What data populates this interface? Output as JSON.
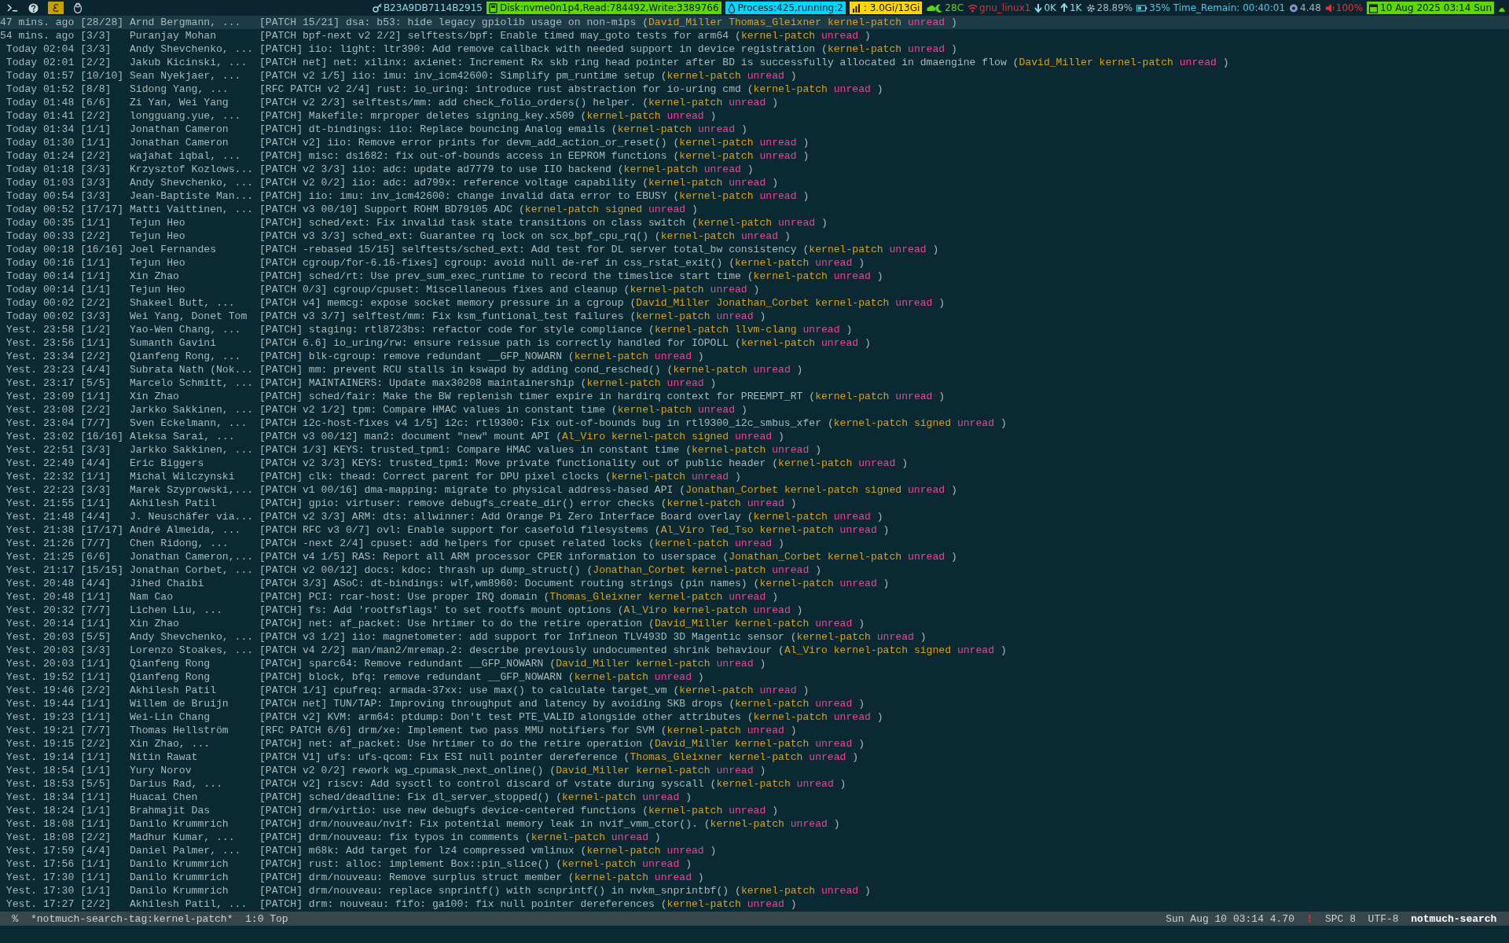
{
  "top_bar": {
    "segments": [
      {
        "kind": "label",
        "text": "B23A9DB7114B2915",
        "color": "#8fd8e8"
      },
      {
        "kind": "badge",
        "text": "Disk:nvme0n1p4,Read:784492,Write:3389766",
        "color": "#5fd700"
      },
      {
        "kind": "badge",
        "text": "Process:425,running:2",
        "color": "#00d7ff"
      },
      {
        "kind": "badge",
        "text": ": 3.0Gi/13Gi",
        "color": "#ffd700"
      },
      {
        "kind": "label",
        "text": "28C",
        "color": "#5fd700"
      },
      {
        "kind": "label",
        "text": "gnu_linux1",
        "color": "#e0303a"
      },
      {
        "kind": "label",
        "text": "0K",
        "color": "#8fd8e8"
      },
      {
        "kind": "label",
        "text": "1K",
        "color": "#8fd8e8"
      },
      {
        "kind": "label",
        "text": "28.89%",
        "color": "#a8b4b8"
      },
      {
        "kind": "label",
        "text": "35% Time_Remain: 00:40:01",
        "color": "#4fc8e8"
      },
      {
        "kind": "label",
        "text": "4.48",
        "color": "#a8b4b8"
      },
      {
        "kind": "label",
        "text": "100%",
        "color": "#f03030"
      },
      {
        "kind": "badge",
        "text": "10 Aug 2025 03:14 Sun",
        "color": "#5fd700"
      }
    ]
  },
  "threads": [
    {
      "selected": true,
      "date": "47 mins. ago",
      "count": "[28/28]",
      "authors": "Arnd Bergmann, ...",
      "subject": "[PATCH 15/21] dsa: b53: hide legacy gpiolib usage on non-mips (",
      "tags": [
        {
          "text": "David_Miller",
          "color": "#d7a020"
        },
        {
          "text": "Thomas_Gleixner",
          "color": "#d7a020"
        },
        {
          "text": "kernel-patch",
          "color": "#d7a020"
        },
        {
          "text": "unread",
          "color": "#e8469a"
        }
      ],
      "end": ")"
    },
    {
      "selected": false,
      "date": "54 mins. ago",
      "count": "[3/3]",
      "authors": "Puranjay Mohan",
      "subject": "[PATCH bpf-next v2 2/2] selftests/bpf: Enable timed may_goto tests for arm64 (",
      "tags": [
        {
          "text": "kernel-patch",
          "color": "#d7a020"
        },
        {
          "text": "unread",
          "color": "#e8469a"
        }
      ],
      "end": ")"
    },
    {
      "selected": false,
      "date": "Today 02:04",
      "count": "[3/3]",
      "authors": "Andy Shevchenko, ...",
      "subject": "[PATCH] iio: light: ltr390: Add remove callback with needed support in device registration (",
      "tags": [
        {
          "text": "kernel-patch",
          "color": "#d7a020"
        },
        {
          "text": "unread",
          "color": "#e8469a"
        }
      ],
      "end": ")"
    },
    {
      "selected": false,
      "date": "Today 02:01",
      "count": "[2/2]",
      "authors": "Jakub Kicinski, ...",
      "subject": "[PATCH net] net: xilinx: axienet: Increment Rx skb ring head pointer after BD is successfully allocated in dmaengine flow (",
      "tags": [
        {
          "text": "David_Miller",
          "color": "#d7a020"
        },
        {
          "text": "kernel-patch",
          "color": "#d7a020"
        },
        {
          "text": "unread",
          "color": "#e8469a"
        }
      ],
      "end": ")"
    },
    {
      "selected": false,
      "date": "Today 01:57",
      "count": "[10/10]",
      "authors": "Sean Nyekjaer, ...",
      "subject": "[PATCH v2 1/5] iio: imu: inv_icm42600: Simplify pm_runtime setup (",
      "tags": [
        {
          "text": "kernel-patch",
          "color": "#d7a020"
        },
        {
          "text": "unread",
          "color": "#e8469a"
        }
      ],
      "end": ")"
    },
    {
      "selected": false,
      "date": "Today 01:52",
      "count": "[8/8]",
      "authors": "Sidong Yang, ...",
      "subject": "[RFC PATCH v2 2/4] rust: io_uring: introduce rust abstraction for io-uring cmd (",
      "tags": [
        {
          "text": "kernel-patch",
          "color": "#d7a020"
        },
        {
          "text": "unread",
          "color": "#e8469a"
        }
      ],
      "end": ")"
    },
    {
      "selected": false,
      "date": "Today 01:48",
      "count": "[6/6]",
      "authors": "Zi Yan, Wei Yang",
      "subject": "[PATCH v2 2/3] selftests/mm: add check_folio_orders() helper. (",
      "tags": [
        {
          "text": "kernel-patch",
          "color": "#d7a020"
        },
        {
          "text": "unread",
          "color": "#e8469a"
        }
      ],
      "end": ")"
    },
    {
      "selected": false,
      "date": "Today 01:41",
      "count": "[2/2]",
      "authors": "longguang.yue, ...",
      "subject": "[PATCH] Makefile: mrproper deletes signing_key.x509 (",
      "tags": [
        {
          "text": "kernel-patch",
          "color": "#d7a020"
        },
        {
          "text": "unread",
          "color": "#e8469a"
        }
      ],
      "end": ")"
    },
    {
      "selected": false,
      "date": "Today 01:34",
      "count": "[1/1]",
      "authors": "Jonathan Cameron",
      "subject": "[PATCH] dt-bindings: iio: Replace bouncing Analog emails (",
      "tags": [
        {
          "text": "kernel-patch",
          "color": "#d7a020"
        },
        {
          "text": "unread",
          "color": "#e8469a"
        }
      ],
      "end": ")"
    },
    {
      "selected": false,
      "date": "Today 01:30",
      "count": "[1/1]",
      "authors": "Jonathan Cameron",
      "subject": "[PATCH v2] iio: Remove error prints for devm_add_action_or_reset() (",
      "tags": [
        {
          "text": "kernel-patch",
          "color": "#d7a020"
        },
        {
          "text": "unread",
          "color": "#e8469a"
        }
      ],
      "end": ")"
    },
    {
      "selected": false,
      "date": "Today 01:24",
      "count": "[2/2]",
      "authors": "wajahat iqbal, ...",
      "subject": "[PATCH] misc: ds1682: fix out-of-bounds access in EEPROM functions (",
      "tags": [
        {
          "text": "kernel-patch",
          "color": "#d7a020"
        },
        {
          "text": "unread",
          "color": "#e8469a"
        }
      ],
      "end": ")"
    },
    {
      "selected": false,
      "date": "Today 01:18",
      "count": "[3/3]",
      "authors": "Krzysztof Kozlows...",
      "subject": "[PATCH v2 3/3] iio: adc: update ad7779 to use IIO backend (",
      "tags": [
        {
          "text": "kernel-patch",
          "color": "#d7a020"
        },
        {
          "text": "unread",
          "color": "#e8469a"
        }
      ],
      "end": ")"
    },
    {
      "selected": false,
      "date": "Today 01:03",
      "count": "[3/3]",
      "authors": "Andy Shevchenko, ...",
      "subject": "[PATCH v2 0/2] iio: adc: ad799x: reference voltage capability (",
      "tags": [
        {
          "text": "kernel-patch",
          "color": "#d7a020"
        },
        {
          "text": "unread",
          "color": "#e8469a"
        }
      ],
      "end": ")"
    },
    {
      "selected": false,
      "date": "Today 00:54",
      "count": "[3/3]",
      "authors": "Jean-Baptiste Man...",
      "subject": "[PATCH] iio: imu: inv_icm42600: change invalid data error to EBUSY (",
      "tags": [
        {
          "text": "kernel-patch",
          "color": "#d7a020"
        },
        {
          "text": "unread",
          "color": "#e8469a"
        }
      ],
      "end": ")"
    },
    {
      "selected": false,
      "date": "Today 00:52",
      "count": "[17/17]",
      "authors": "Matti Vaittinen, ...",
      "subject": "[PATCH v3 00/10] Support ROHM BD79105 ADC (",
      "tags": [
        {
          "text": "kernel-patch",
          "color": "#d7a020"
        },
        {
          "text": "signed",
          "color": "#d7a020"
        },
        {
          "text": "unread",
          "color": "#e8469a"
        }
      ],
      "end": ")"
    },
    {
      "selected": false,
      "date": "Today 00:35",
      "count": "[1/1]",
      "authors": "Tejun Heo",
      "subject": "[PATCH] sched/ext: Fix invalid task state transitions on class switch (",
      "tags": [
        {
          "text": "kernel-patch",
          "color": "#d7a020"
        },
        {
          "text": "unread",
          "color": "#e8469a"
        }
      ],
      "end": ")"
    },
    {
      "selected": false,
      "date": "Today 00:33",
      "count": "[2/2]",
      "authors": "Tejun Heo",
      "subject": "[PATCH v3 3/3] sched_ext: Guarantee rq lock on scx_bpf_cpu_rq() (",
      "tags": [
        {
          "text": "kernel-patch",
          "color": "#d7a020"
        },
        {
          "text": "unread",
          "color": "#e8469a"
        }
      ],
      "end": ")"
    },
    {
      "selected": false,
      "date": "Today 00:18",
      "count": "[16/16]",
      "authors": "Joel Fernandes",
      "subject": "[PATCH -rebased 15/15] selftests/sched_ext: Add test for DL server total_bw consistency (",
      "tags": [
        {
          "text": "kernel-patch",
          "color": "#d7a020"
        },
        {
          "text": "unread",
          "color": "#e8469a"
        }
      ],
      "end": ")"
    },
    {
      "selected": false,
      "date": "Today 00:16",
      "count": "[1/1]",
      "authors": "Tejun Heo",
      "subject": "[PATCH cgroup/for-6.16-fixes] cgroup: avoid null de-ref in css_rstat_exit() (",
      "tags": [
        {
          "text": "kernel-patch",
          "color": "#d7a020"
        },
        {
          "text": "unread",
          "color": "#e8469a"
        }
      ],
      "end": ")"
    },
    {
      "selected": false,
      "date": "Today 00:14",
      "count": "[1/1]",
      "authors": "Xin Zhao",
      "subject": "[PATCH] sched/rt: Use prev_sum_exec_runtime to record the timeslice start time (",
      "tags": [
        {
          "text": "kernel-patch",
          "color": "#d7a020"
        },
        {
          "text": "unread",
          "color": "#e8469a"
        }
      ],
      "end": ")"
    },
    {
      "selected": false,
      "date": "Today 00:14",
      "count": "[1/1]",
      "authors": "Tejun Heo",
      "subject": "[PATCH 0/3] cgroup/cpuset: Miscellaneous fixes and cleanup (",
      "tags": [
        {
          "text": "kernel-patch",
          "color": "#d7a020"
        },
        {
          "text": "unread",
          "color": "#e8469a"
        }
      ],
      "end": ")"
    },
    {
      "selected": false,
      "date": "Today 00:02",
      "count": "[2/2]",
      "authors": "Shakeel Butt, ...",
      "subject": "[PATCH v4] memcg: expose socket memory pressure in a cgroup (",
      "tags": [
        {
          "text": "David_Miller",
          "color": "#d7a020"
        },
        {
          "text": "Jonathan_Corbet",
          "color": "#d7a020"
        },
        {
          "text": "kernel-patch",
          "color": "#d7a020"
        },
        {
          "text": "unread",
          "color": "#e8469a"
        }
      ],
      "end": ")"
    },
    {
      "selected": false,
      "date": "Today 00:02",
      "count": "[3/3]",
      "authors": "Wei Yang, Donet Tom",
      "subject": "[PATCH v3 3/7] selftest/mm: Fix ksm_funtional_test failures (",
      "tags": [
        {
          "text": "kernel-patch",
          "color": "#d7a020"
        },
        {
          "text": "unread",
          "color": "#e8469a"
        }
      ],
      "end": ")"
    },
    {
      "selected": false,
      "date": "Yest. 23:58",
      "count": "[1/2]",
      "authors": "Yao-Wen Chang, ...",
      "subject": "[PATCH] staging: rtl8723bs: refactor code for style compliance (",
      "tags": [
        {
          "text": "kernel-patch",
          "color": "#d7a020"
        },
        {
          "text": "llvm-clang",
          "color": "#d7a020"
        },
        {
          "text": "unread",
          "color": "#e8469a"
        }
      ],
      "end": ")"
    },
    {
      "selected": false,
      "date": "Yest. 23:56",
      "count": "[1/1]",
      "authors": "Sumanth Gavini",
      "subject": "[PATCH 6.6] io_uring/rw: ensure reissue path is correctly handled for IOPOLL (",
      "tags": [
        {
          "text": "kernel-patch",
          "color": "#d7a020"
        },
        {
          "text": "unread",
          "color": "#e8469a"
        }
      ],
      "end": ")"
    },
    {
      "selected": false,
      "date": "Yest. 23:34",
      "count": "[2/2]",
      "authors": "Qianfeng Rong, ...",
      "subject": "[PATCH] blk-cgroup: remove redundant __GFP_NOWARN (",
      "tags": [
        {
          "text": "kernel-patch",
          "color": "#d7a020"
        },
        {
          "text": "unread",
          "color": "#e8469a"
        }
      ],
      "end": ")"
    },
    {
      "selected": false,
      "date": "Yest. 23:23",
      "count": "[4/4]",
      "authors": "Subrata Nath (Nok...",
      "subject": "[PATCH] mm: prevent RCU stalls in kswapd by adding cond_resched() (",
      "tags": [
        {
          "text": "kernel-patch",
          "color": "#d7a020"
        },
        {
          "text": "unread",
          "color": "#e8469a"
        }
      ],
      "end": ")"
    },
    {
      "selected": false,
      "date": "Yest. 23:17",
      "count": "[5/5]",
      "authors": "Marcelo Schmitt, ...",
      "subject": "[PATCH] MAINTAINERS: Update max30208 maintainership (",
      "tags": [
        {
          "text": "kernel-patch",
          "color": "#d7a020"
        },
        {
          "text": "unread",
          "color": "#e8469a"
        }
      ],
      "end": ")"
    },
    {
      "selected": false,
      "date": "Yest. 23:09",
      "count": "[1/1]",
      "authors": "Xin Zhao",
      "subject": "[PATCH] sched/fair: Make the BW replenish timer expire in hardirq context for PREEMPT_RT (",
      "tags": [
        {
          "text": "kernel-patch",
          "color": "#d7a020"
        },
        {
          "text": "unread",
          "color": "#e8469a"
        }
      ],
      "end": ")"
    },
    {
      "selected": false,
      "date": "Yest. 23:08",
      "count": "[2/2]",
      "authors": "Jarkko Sakkinen, ...",
      "subject": "[PATCH v2 1/2] tpm: Compare HMAC values in constant time (",
      "tags": [
        {
          "text": "kernel-patch",
          "color": "#d7a020"
        },
        {
          "text": "unread",
          "color": "#e8469a"
        }
      ],
      "end": ")"
    },
    {
      "selected": false,
      "date": "Yest. 23:04",
      "count": "[7/7]",
      "authors": "Sven Eckelmann, ...",
      "subject": "[PATCH i2c-host-fixes v4 1/5] i2c: rtl9300: Fix out-of-bounds bug in rtl9300_i2c_smbus_xfer (",
      "tags": [
        {
          "text": "kernel-patch",
          "color": "#d7a020"
        },
        {
          "text": "signed",
          "color": "#d7a020"
        },
        {
          "text": "unread",
          "color": "#e8469a"
        }
      ],
      "end": ")"
    },
    {
      "selected": false,
      "date": "Yest. 23:02",
      "count": "[16/16]",
      "authors": "Aleksa Sarai, ...",
      "subject": "[PATCH v3 00/12] man2: document \"new\" mount API (",
      "tags": [
        {
          "text": "Al_Viro",
          "color": "#d7a020"
        },
        {
          "text": "kernel-patch",
          "color": "#d7a020"
        },
        {
          "text": "signed",
          "color": "#d7a020"
        },
        {
          "text": "unread",
          "color": "#e8469a"
        }
      ],
      "end": ")"
    },
    {
      "selected": false,
      "date": "Yest. 22:51",
      "count": "[3/3]",
      "authors": "Jarkko Sakkinen, ...",
      "subject": "[PATCH 1/3] KEYS: trusted_tpm1: Compare HMAC values in constant time (",
      "tags": [
        {
          "text": "kernel-patch",
          "color": "#d7a020"
        },
        {
          "text": "unread",
          "color": "#e8469a"
        }
      ],
      "end": ")"
    },
    {
      "selected": false,
      "date": "Yest. 22:49",
      "count": "[4/4]",
      "authors": "Eric Biggers",
      "subject": "[PATCH v2 3/3] KEYS: trusted_tpm1: Move private functionality out of public header (",
      "tags": [
        {
          "text": "kernel-patch",
          "color": "#d7a020"
        },
        {
          "text": "unread",
          "color": "#e8469a"
        }
      ],
      "end": ")"
    },
    {
      "selected": false,
      "date": "Yest. 22:32",
      "count": "[1/1]",
      "authors": "Michal Wilczynski",
      "subject": "[PATCH] clk: thead: Correct parent for DPU pixel clocks (",
      "tags": [
        {
          "text": "kernel-patch",
          "color": "#d7a020"
        },
        {
          "text": "unread",
          "color": "#e8469a"
        }
      ],
      "end": ")"
    },
    {
      "selected": false,
      "date": "Yest. 22:23",
      "count": "[3/3]",
      "authors": "Marek Szyprowski,...",
      "subject": "[PATCH v1 00/16] dma-mapping: migrate to physical address-based API (",
      "tags": [
        {
          "text": "Jonathan_Corbet",
          "color": "#d7a020"
        },
        {
          "text": "kernel-patch",
          "color": "#d7a020"
        },
        {
          "text": "signed",
          "color": "#d7a020"
        },
        {
          "text": "unread",
          "color": "#e8469a"
        }
      ],
      "end": ")"
    },
    {
      "selected": false,
      "date": "Yest. 21:55",
      "count": "[1/1]",
      "authors": "Akhilesh Patil",
      "subject": "[PATCH] gpio: virtuser: remove debugfs_create_dir() error checks (",
      "tags": [
        {
          "text": "kernel-patch",
          "color": "#d7a020"
        },
        {
          "text": "unread",
          "color": "#e8469a"
        }
      ],
      "end": ")"
    },
    {
      "selected": false,
      "date": "Yest. 21:48",
      "count": "[4/4]",
      "authors": "J. Neuschäfer via...",
      "subject": "[PATCH v2 3/3] ARM: dts: allwinner: Add Orange Pi Zero Interface Board overlay (",
      "tags": [
        {
          "text": "kernel-patch",
          "color": "#d7a020"
        },
        {
          "text": "unread",
          "color": "#e8469a"
        }
      ],
      "end": ")"
    },
    {
      "selected": false,
      "date": "Yest. 21:38",
      "count": "[17/17]",
      "authors": "André Almeida, ...",
      "subject": "[PATCH RFC v3 0/7] ovl: Enable support for casefold filesystems (",
      "tags": [
        {
          "text": "Al_Viro",
          "color": "#d7a020"
        },
        {
          "text": "Ted_Tso",
          "color": "#d7a020"
        },
        {
          "text": "kernel-patch",
          "color": "#d7a020"
        },
        {
          "text": "unread",
          "color": "#e8469a"
        }
      ],
      "end": ")"
    },
    {
      "selected": false,
      "date": "Yest. 21:26",
      "count": "[7/7]",
      "authors": "Chen Ridong, ...",
      "subject": "[PATCH -next 2/4] cpuset: add helpers for cpuset related locks (",
      "tags": [
        {
          "text": "kernel-patch",
          "color": "#d7a020"
        },
        {
          "text": "unread",
          "color": "#e8469a"
        }
      ],
      "end": ")"
    },
    {
      "selected": false,
      "date": "Yest. 21:25",
      "count": "[6/6]",
      "authors": "Jonathan Cameron,...",
      "subject": "[PATCH v4 1/5] RAS: Report all ARM processor CPER information to userspace (",
      "tags": [
        {
          "text": "Jonathan_Corbet",
          "color": "#d7a020"
        },
        {
          "text": "kernel-patch",
          "color": "#d7a020"
        },
        {
          "text": "unread",
          "color": "#e8469a"
        }
      ],
      "end": ")"
    },
    {
      "selected": false,
      "date": "Yest. 21:17",
      "count": "[15/15]",
      "authors": "Jonathan Corbet, ...",
      "subject": "[PATCH v2 00/12] docs: kdoc: thrash up dump_struct() (",
      "tags": [
        {
          "text": "Jonathan_Corbet",
          "color": "#d7a020"
        },
        {
          "text": "kernel-patch",
          "color": "#d7a020"
        },
        {
          "text": "unread",
          "color": "#e8469a"
        }
      ],
      "end": ")"
    },
    {
      "selected": false,
      "date": "Yest. 20:48",
      "count": "[4/4]",
      "authors": "Jihed Chaibi",
      "subject": "[PATCH 3/3] ASoC: dt-bindings: wlf,wm8960: Document routing strings (pin names) (",
      "tags": [
        {
          "text": "kernel-patch",
          "color": "#d7a020"
        },
        {
          "text": "unread",
          "color": "#e8469a"
        }
      ],
      "end": ")"
    },
    {
      "selected": false,
      "date": "Yest. 20:48",
      "count": "[1/1]",
      "authors": "Nam Cao",
      "subject": "[PATCH] PCI: rcar-host: Use proper IRQ domain (",
      "tags": [
        {
          "text": "Thomas_Gleixner",
          "color": "#d7a020"
        },
        {
          "text": "kernel-patch",
          "color": "#d7a020"
        },
        {
          "text": "unread",
          "color": "#e8469a"
        }
      ],
      "end": ")"
    },
    {
      "selected": false,
      "date": "Yest. 20:32",
      "count": "[7/7]",
      "authors": "Lichen Liu, ...",
      "subject": "[PATCH] fs: Add 'rootfsflags' to set rootfs mount options (",
      "tags": [
        {
          "text": "Al_Viro",
          "color": "#d7a020"
        },
        {
          "text": "kernel-patch",
          "color": "#d7a020"
        },
        {
          "text": "unread",
          "color": "#e8469a"
        }
      ],
      "end": ")"
    },
    {
      "selected": false,
      "date": "Yest. 20:14",
      "count": "[1/1]",
      "authors": "Xin Zhao",
      "subject": "[PATCH] net: af_packet: Use hrtimer to do the retire operation (",
      "tags": [
        {
          "text": "David_Miller",
          "color": "#d7a020"
        },
        {
          "text": "kernel-patch",
          "color": "#d7a020"
        },
        {
          "text": "unread",
          "color": "#e8469a"
        }
      ],
      "end": ")"
    },
    {
      "selected": false,
      "date": "Yest. 20:03",
      "count": "[5/5]",
      "authors": "Andy Shevchenko, ...",
      "subject": "[PATCH v3 1/2] iio: magnetometer: add support for Infineon TLV493D 3D Magentic sensor (",
      "tags": [
        {
          "text": "kernel-patch",
          "color": "#d7a020"
        },
        {
          "text": "unread",
          "color": "#e8469a"
        }
      ],
      "end": ")"
    },
    {
      "selected": false,
      "date": "Yest. 20:03",
      "count": "[3/3]",
      "authors": "Lorenzo Stoakes, ...",
      "subject": "[PATCH v4 2/2] man/man2/mremap.2: describe previously undocumented shrink behaviour (",
      "tags": [
        {
          "text": "Al_Viro",
          "color": "#d7a020"
        },
        {
          "text": "kernel-patch",
          "color": "#d7a020"
        },
        {
          "text": "signed",
          "color": "#d7a020"
        },
        {
          "text": "unread",
          "color": "#e8469a"
        }
      ],
      "end": ")"
    },
    {
      "selected": false,
      "date": "Yest. 20:03",
      "count": "[1/1]",
      "authors": "Qianfeng Rong",
      "subject": "[PATCH] sparc64: Remove redundant __GFP_NOWARN (",
      "tags": [
        {
          "text": "David_Miller",
          "color": "#d7a020"
        },
        {
          "text": "kernel-patch",
          "color": "#d7a020"
        },
        {
          "text": "unread",
          "color": "#e8469a"
        }
      ],
      "end": ")"
    },
    {
      "selected": false,
      "date": "Yest. 19:52",
      "count": "[1/1]",
      "authors": "Qianfeng Rong",
      "subject": "[PATCH] block, bfq: remove redundant __GFP_NOWARN (",
      "tags": [
        {
          "text": "kernel-patch",
          "color": "#d7a020"
        },
        {
          "text": "unread",
          "color": "#e8469a"
        }
      ],
      "end": ")"
    },
    {
      "selected": false,
      "date": "Yest. 19:46",
      "count": "[2/2]",
      "authors": "Akhilesh Patil",
      "subject": "[PATCH 1/1] cpufreq: armada-37xx: use max() to calculate target_vm (",
      "tags": [
        {
          "text": "kernel-patch",
          "color": "#d7a020"
        },
        {
          "text": "unread",
          "color": "#e8469a"
        }
      ],
      "end": ")"
    },
    {
      "selected": false,
      "date": "Yest. 19:44",
      "count": "[1/1]",
      "authors": "Willem de Bruijn",
      "subject": "[PATCH net] TUN/TAP: Improving throughput and latency by avoiding SKB drops (",
      "tags": [
        {
          "text": "kernel-patch",
          "color": "#d7a020"
        },
        {
          "text": "unread",
          "color": "#e8469a"
        }
      ],
      "end": ")"
    },
    {
      "selected": false,
      "date": "Yest. 19:23",
      "count": "[1/1]",
      "authors": "Wei-Lin Chang",
      "subject": "[PATCH v2] KVM: arm64: ptdump: Don't test PTE_VALID alongside other attributes (",
      "tags": [
        {
          "text": "kernel-patch",
          "color": "#d7a020"
        },
        {
          "text": "unread",
          "color": "#e8469a"
        }
      ],
      "end": ")"
    },
    {
      "selected": false,
      "date": "Yest. 19:21",
      "count": "[7/7]",
      "authors": "Thomas Hellström",
      "subject": "[RFC PATCH 6/6] drm/xe: Implement two pass MMU notifiers for SVM (",
      "tags": [
        {
          "text": "kernel-patch",
          "color": "#d7a020"
        },
        {
          "text": "unread",
          "color": "#e8469a"
        }
      ],
      "end": ")"
    },
    {
      "selected": false,
      "date": "Yest. 19:15",
      "count": "[2/2]",
      "authors": "Xin Zhao, ...",
      "subject": "[PATCH] net: af_packet: Use hrtimer to do the retire operation (",
      "tags": [
        {
          "text": "David_Miller",
          "color": "#d7a020"
        },
        {
          "text": "kernel-patch",
          "color": "#d7a020"
        },
        {
          "text": "unread",
          "color": "#e8469a"
        }
      ],
      "end": ")"
    },
    {
      "selected": false,
      "date": "Yest. 19:14",
      "count": "[1/1]",
      "authors": "Nitin Rawat",
      "subject": "[PATCH V1] ufs: ufs-qcom: Fix ESI null pointer dereference (",
      "tags": [
        {
          "text": "Thomas_Gleixner",
          "color": "#d7a020"
        },
        {
          "text": "kernel-patch",
          "color": "#d7a020"
        },
        {
          "text": "unread",
          "color": "#e8469a"
        }
      ],
      "end": ")"
    },
    {
      "selected": false,
      "date": "Yest. 18:54",
      "count": "[1/1]",
      "authors": "Yury Norov",
      "subject": "[PATCH v2 0/2] rework wg_cpumask_next_online() (",
      "tags": [
        {
          "text": "David_Miller",
          "color": "#d7a020"
        },
        {
          "text": "kernel-patch",
          "color": "#d7a020"
        },
        {
          "text": "unread",
          "color": "#e8469a"
        }
      ],
      "end": ")"
    },
    {
      "selected": false,
      "date": "Yest. 18:53",
      "count": "[5/5]",
      "authors": "Darius Rad, ...",
      "subject": "[PATCH v2] riscv: Add sysctl to control discard of vstate during syscall (",
      "tags": [
        {
          "text": "kernel-patch",
          "color": "#d7a020"
        },
        {
          "text": "unread",
          "color": "#e8469a"
        }
      ],
      "end": ")"
    },
    {
      "selected": false,
      "date": "Yest. 18:34",
      "count": "[1/1]",
      "authors": "Huacai Chen",
      "subject": "[PATCH] sched/deadline: Fix dl_server_stopped() (",
      "tags": [
        {
          "text": "kernel-patch",
          "color": "#d7a020"
        },
        {
          "text": "unread",
          "color": "#e8469a"
        }
      ],
      "end": ")"
    },
    {
      "selected": false,
      "date": "Yest. 18:24",
      "count": "[1/1]",
      "authors": "Brahmajit Das",
      "subject": "[PATCH] drm/virtio: use new debugfs device-centered functions (",
      "tags": [
        {
          "text": "kernel-patch",
          "color": "#d7a020"
        },
        {
          "text": "unread",
          "color": "#e8469a"
        }
      ],
      "end": ")"
    },
    {
      "selected": false,
      "date": "Yest. 18:08",
      "count": "[1/1]",
      "authors": "Danilo Krummrich",
      "subject": "[PATCH] drm/nouveau/nvif: Fix potential memory leak in nvif_vmm_ctor(). (",
      "tags": [
        {
          "text": "kernel-patch",
          "color": "#d7a020"
        },
        {
          "text": "unread",
          "color": "#e8469a"
        }
      ],
      "end": ")"
    },
    {
      "selected": false,
      "date": "Yest. 18:08",
      "count": "[2/2]",
      "authors": "Madhur Kumar, ...",
      "subject": "[PATCH] drm/nouveau: fix typos in comments (",
      "tags": [
        {
          "text": "kernel-patch",
          "color": "#d7a020"
        },
        {
          "text": "unread",
          "color": "#e8469a"
        }
      ],
      "end": ")"
    },
    {
      "selected": false,
      "date": "Yest. 17:59",
      "count": "[4/4]",
      "authors": "Daniel Palmer, ...",
      "subject": "[PATCH] m68k: Add target for lz4 compressed vmlinux (",
      "tags": [
        {
          "text": "kernel-patch",
          "color": "#d7a020"
        },
        {
          "text": "unread",
          "color": "#e8469a"
        }
      ],
      "end": ")"
    },
    {
      "selected": false,
      "date": "Yest. 17:56",
      "count": "[1/1]",
      "authors": "Danilo Krummrich",
      "subject": "[PATCH] rust: alloc: implement Box::pin_slice() (",
      "tags": [
        {
          "text": "kernel-patch",
          "color": "#d7a020"
        },
        {
          "text": "unread",
          "color": "#e8469a"
        }
      ],
      "end": ")"
    },
    {
      "selected": false,
      "date": "Yest. 17:30",
      "count": "[1/1]",
      "authors": "Danilo Krummrich",
      "subject": "[PATCH] drm/nouveau: Remove surplus struct member (",
      "tags": [
        {
          "text": "kernel-patch",
          "color": "#d7a020"
        },
        {
          "text": "unread",
          "color": "#e8469a"
        }
      ],
      "end": ")"
    },
    {
      "selected": false,
      "date": "Yest. 17:30",
      "count": "[1/1]",
      "authors": "Danilo Krummrich",
      "subject": "[PATCH] drm/nouveau: replace snprintf() with scnprintf() in nvkm_snprintbf() (",
      "tags": [
        {
          "text": "kernel-patch",
          "color": "#d7a020"
        },
        {
          "text": "unread",
          "color": "#e8469a"
        }
      ],
      "end": ")"
    },
    {
      "selected": false,
      "date": "Yest. 17:27",
      "count": "[2/2]",
      "authors": "Akhilesh Patil, ...",
      "subject": "[PATCH] drm: nouveau: fifo: ga100: fix null pointer dereferences (",
      "tags": [
        {
          "text": "kernel-patch",
          "color": "#d7a020"
        },
        {
          "text": "unread",
          "color": "#e8469a"
        }
      ],
      "end": ")"
    }
  ],
  "mode_line": {
    "left": [
      {
        "kind": "plain",
        "text": "%"
      },
      {
        "kind": "plain",
        "text": "*notmuch-search-tag:kernel-patch*"
      },
      {
        "kind": "plain",
        "text": "1:0 Top"
      }
    ],
    "right": [
      {
        "kind": "plain",
        "text": "Sun Aug 10 03:14 4.70"
      },
      {
        "kind": "warning",
        "text": "!"
      },
      {
        "kind": "plain",
        "text": "SPC 8"
      },
      {
        "kind": "plain",
        "text": "UTF-8"
      },
      {
        "kind": "major",
        "text": "notmuch-search"
      }
    ]
  }
}
